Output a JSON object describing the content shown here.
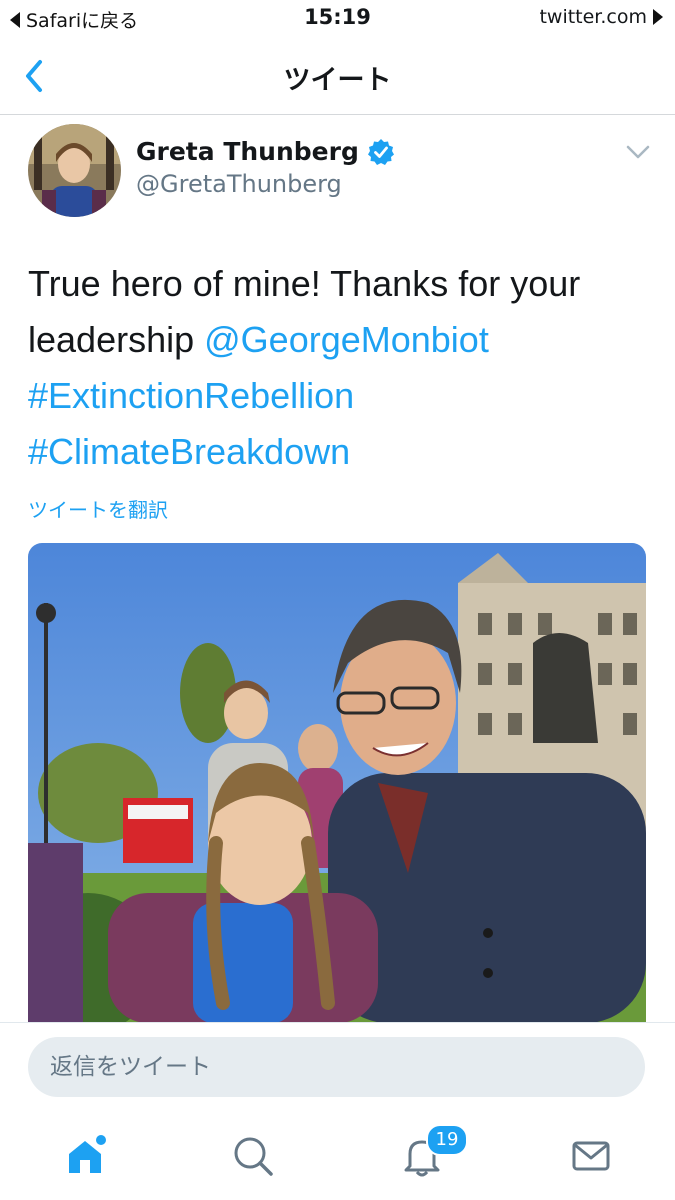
{
  "status_bar": {
    "back_app": "Safariに戻る",
    "time": "15:19",
    "site": "twitter.com"
  },
  "nav": {
    "title": "ツイート",
    "back_icon": "chevron-left-icon"
  },
  "tweet": {
    "author_name": "Greta Thunberg",
    "handle": "@GretaThunberg",
    "verified": true,
    "text_plain": "True hero of mine! Thanks for your leadership ",
    "mention": "@GeorgeMonbiot",
    "hashtags": [
      "#ExtinctionRebellion",
      "#ClimateBreakdown"
    ],
    "translate_label": "ツイートを翻訳"
  },
  "reply": {
    "placeholder": "返信をツイート"
  },
  "tabbar": {
    "items": [
      {
        "icon": "home-icon",
        "active": true
      },
      {
        "icon": "search-icon",
        "active": false
      },
      {
        "icon": "bell-icon",
        "active": false
      },
      {
        "icon": "mail-icon",
        "active": false
      }
    ],
    "notification_count": "19"
  },
  "colors": {
    "accent": "#1da1f2",
    "text": "#14171a",
    "secondary": "#657786"
  }
}
